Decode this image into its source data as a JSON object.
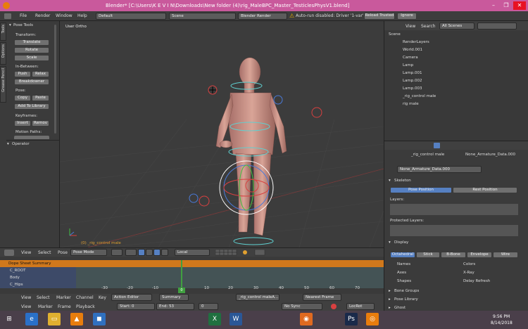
{
  "window": {
    "title": "Blender* [C:\\Users\\K E V I N\\Downloads\\New folder (4)\\rig_MaleBPC_Master_TesticlesPhysV1.blend]"
  },
  "info_header": {
    "menus": [
      "File",
      "Render",
      "Window",
      "Help"
    ],
    "layout": "Default",
    "scene": "Scene",
    "engine": "Blender Render",
    "warning": "Auto-run disabled: Driver '1-var'",
    "reload_label": "Reload Trusted",
    "ignore_label": "Ignore"
  },
  "tool_shelf": {
    "tabs": [
      "Tools",
      "Options",
      "Grease Pencil"
    ],
    "panel_title": "Pose Tools",
    "transform_label": "Transform:",
    "transform_buttons": [
      "Translate",
      "Rotate",
      "Scale"
    ],
    "inbetween_label": "In-Between:",
    "push_label": "Push",
    "relax_label": "Relax",
    "breakdowner_label": "Breakdowner",
    "pose_label": "Pose:",
    "copy_label": "Copy",
    "paste_label": "Paste",
    "add_library_label": "Add To Library",
    "keyframes_label": "Keyframes:",
    "insert_label": "Insert",
    "remove_label": "Remov",
    "motion_paths_label": "Motion Paths:",
    "operator_label": "Operator"
  },
  "viewport": {
    "view_label": "User Ortho",
    "object_label": "(0) _rig_control male"
  },
  "view3d_header": {
    "menus": [
      "View",
      "Select",
      "Pose"
    ],
    "mode": "Pose Mode",
    "orientation": "Local"
  },
  "dopesheet": {
    "rows": [
      "Dope Sheet Summary",
      "C_ROOT",
      "Body",
      "C_Hips"
    ],
    "ticks": [
      "-30",
      "-20",
      "-10",
      "0",
      "10",
      "20",
      "30",
      "40",
      "50",
      "60",
      "70"
    ],
    "current_frame": "0"
  },
  "timeline_header": {
    "menus": [
      "View",
      "Select",
      "Marker",
      "Channel",
      "Key"
    ],
    "editor": "Action Editor",
    "summary": "Summary",
    "action": "_rig_control maleA...",
    "interp": "Nearest Frame",
    "menus2": [
      "View",
      "Marker",
      "Frame",
      "Playback"
    ],
    "start": "Start:",
    "start_val": "0",
    "end": "End:",
    "end_val": "53",
    "current": "0",
    "sync": "No Sync",
    "locrot": "LocRot"
  },
  "outliner": {
    "menus": [
      "View",
      "Search"
    ],
    "filter": "All Scenes",
    "items": [
      "Scene",
      "RenderLayers",
      "World.001",
      "Camera",
      "Lamp",
      "Lamp.001",
      "Lamp.002",
      "Lamp.003",
      "_rig_control male",
      "rig male"
    ]
  },
  "properties": {
    "breadcrumb_obj": "_rig_control male",
    "breadcrumb_data": "None_Armature_Data.000",
    "datablock": "None_Armature_Data.000",
    "skeleton_title": "Skeleton",
    "pose_position": "Pose Position",
    "rest_position": "Rest Position",
    "layers_label": "Layers:",
    "protected_label": "Protected Layers:",
    "display_title": "Display",
    "display_types": [
      "Octahedral",
      "Stick",
      "B-Bone",
      "Envelope",
      "Wire"
    ],
    "names": "Names",
    "axes": "Axes",
    "shapes": "Shapes",
    "colors": "Colors",
    "xray": "X-Ray",
    "delay": "Delay Refresh",
    "bone_groups": "Bone Groups",
    "pose_library": "Pose Library",
    "ghost": "Ghost"
  },
  "taskbar": {
    "time": "9:56 PM",
    "date": "8/14/2018"
  },
  "colors": {
    "accent": "#5680c2",
    "titlebar": "#c9599c",
    "orange": "#d0781c"
  }
}
